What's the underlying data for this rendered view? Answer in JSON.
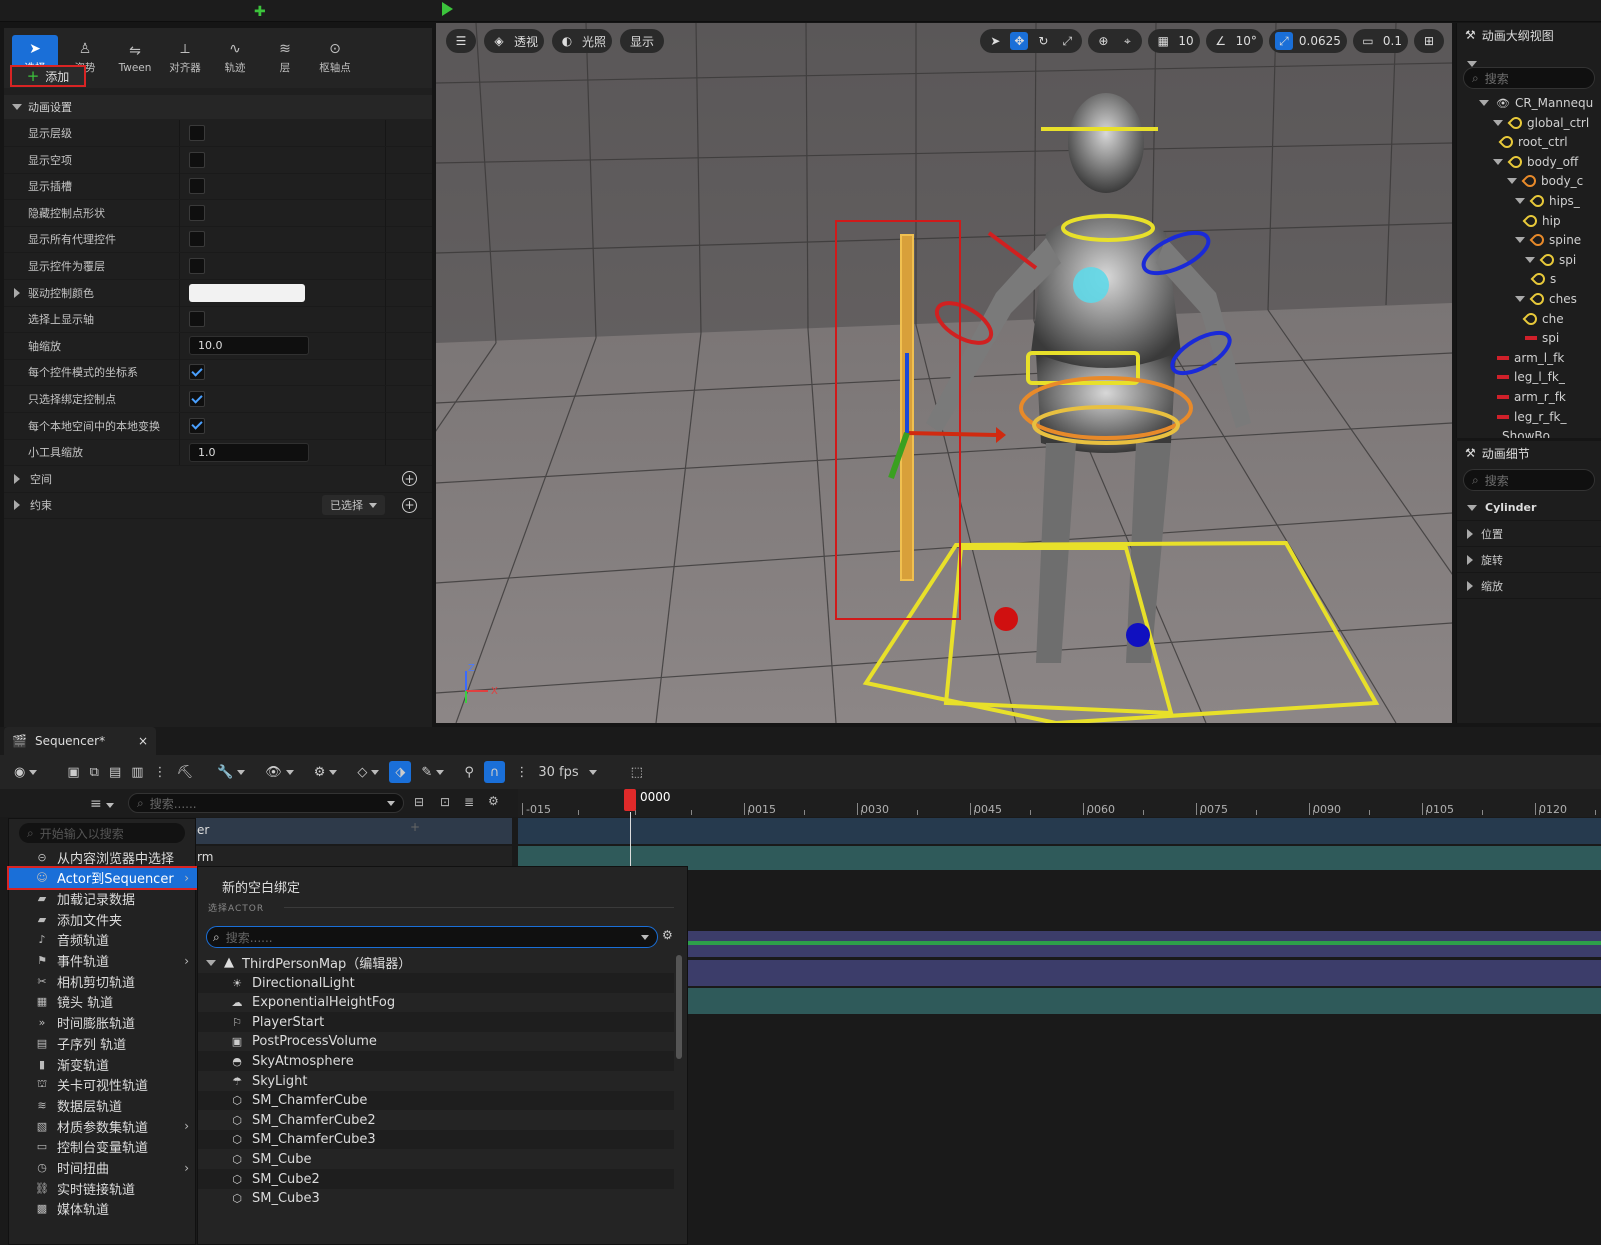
{
  "mode_tabs": [
    {
      "label": "选择",
      "icon": "select-icon"
    },
    {
      "label": "姿势",
      "icon": "pose-icon"
    },
    {
      "label": "Tween",
      "icon": "tween-icon"
    },
    {
      "label": "对齐器",
      "icon": "aligner-icon"
    },
    {
      "label": "轨迹",
      "icon": "trail-icon"
    },
    {
      "label": "层",
      "icon": "layer-icon"
    },
    {
      "label": "枢轴点",
      "icon": "pivot-icon"
    }
  ],
  "anim_settings": {
    "title": "动画设置",
    "rows": [
      {
        "label": "显示层级",
        "type": "checkbox",
        "checked": false
      },
      {
        "label": "显示空项",
        "type": "checkbox",
        "checked": false
      },
      {
        "label": "显示插槽",
        "type": "checkbox",
        "checked": false
      },
      {
        "label": "隐藏控制点形状",
        "type": "checkbox",
        "checked": false
      },
      {
        "label": "显示所有代理控件",
        "type": "checkbox",
        "checked": false
      },
      {
        "label": "显示控件为覆层",
        "type": "checkbox",
        "checked": false
      },
      {
        "label": "驱动控制颜色",
        "type": "color",
        "value": "#f2f2f2"
      },
      {
        "label": "选择上显示轴",
        "type": "checkbox",
        "checked": false
      },
      {
        "label": "轴缩放",
        "type": "number",
        "value": "10.0"
      },
      {
        "label": "每个控件模式的坐标系",
        "type": "checkbox",
        "checked": true
      },
      {
        "label": "只选择绑定控制点",
        "type": "checkbox",
        "checked": true
      },
      {
        "label": "每个本地空间中的本地变换",
        "type": "checkbox",
        "checked": true
      },
      {
        "label": "小工具缩放",
        "type": "number",
        "value": "1.0"
      }
    ],
    "space_label": "空间",
    "constraint_label": "约束",
    "constraint_dropdown": "已选择"
  },
  "viewport": {
    "perspective_label": "透视",
    "lighting_label": "光照",
    "show_label": "显示",
    "grid_snap": "10",
    "angle_snap": "10°",
    "scale_snap": "0.0625",
    "camera_speed": "0.1",
    "axis_x": "X",
    "axis_z": "Z"
  },
  "outliner": {
    "title": "动画大纲视图",
    "search_placeholder": "搜索",
    "items": [
      {
        "label": "CR_Mannequ",
        "kind": "eye"
      },
      {
        "label": "global_ctrl",
        "kind": "bone"
      },
      {
        "label": "root_ctrl",
        "kind": "bone"
      },
      {
        "label": "body_off",
        "kind": "bone"
      },
      {
        "label": "body_c",
        "kind": "bone-orange"
      },
      {
        "label": "hips_",
        "kind": "bone"
      },
      {
        "label": "hip",
        "kind": "bone"
      },
      {
        "label": "spine",
        "kind": "bone-orange"
      },
      {
        "label": "spi",
        "kind": "bone"
      },
      {
        "label": "s",
        "kind": "bone"
      },
      {
        "label": "ches",
        "kind": "bone"
      },
      {
        "label": "che",
        "kind": "bone"
      },
      {
        "label": "spi",
        "kind": "red"
      },
      {
        "label": "arm_l_fk",
        "kind": "red"
      },
      {
        "label": "leg_l_fk_",
        "kind": "red"
      },
      {
        "label": "arm_r_fk",
        "kind": "red"
      },
      {
        "label": "leg_r_fk_",
        "kind": "red"
      },
      {
        "label": "ShowBo",
        "kind": "none"
      }
    ]
  },
  "details": {
    "title": "动画细节",
    "search_placeholder": "搜索",
    "section": "Cylinder",
    "rows": [
      "位置",
      "旋转",
      "缩放"
    ]
  },
  "sequencer": {
    "tab_label": "Sequencer*",
    "fps": "30 fps",
    "add_label": "添加",
    "search_placeholder": "搜索......",
    "playhead_frame": "0000",
    "ticks": [
      "-015",
      "0015",
      "0030",
      "0045",
      "0060",
      "0075",
      "0090",
      "0105",
      "0120"
    ],
    "track_label_1": "er",
    "track_label_2": "rm"
  },
  "add_menu": {
    "search_placeholder": "开始输入以搜索",
    "items": [
      {
        "label": "从内容浏览器中选择",
        "icon": "content-browser-icon",
        "sub": false
      },
      {
        "label": "Actor到Sequencer",
        "icon": "actor-icon",
        "sub": true,
        "highlight": true
      },
      {
        "label": "加载记录数据",
        "icon": "folder-icon",
        "sub": false
      },
      {
        "label": "添加文件夹",
        "icon": "folder-icon",
        "sub": false
      },
      {
        "label": "音频轨道",
        "icon": "audio-icon",
        "sub": false
      },
      {
        "label": "事件轨道",
        "icon": "event-icon",
        "sub": true
      },
      {
        "label": "相机剪切轨道",
        "icon": "camera-cut-icon",
        "sub": false
      },
      {
        "label": "镜头 轨道",
        "icon": "shot-icon",
        "sub": false
      },
      {
        "label": "时间膨胀轨道",
        "icon": "time-dilation-icon",
        "sub": false
      },
      {
        "label": "子序列 轨道",
        "icon": "subsequence-icon",
        "sub": false
      },
      {
        "label": "渐变轨道",
        "icon": "fade-icon",
        "sub": false
      },
      {
        "label": "关卡可视性轨道",
        "icon": "level-visibility-icon",
        "sub": false
      },
      {
        "label": "数据层轨道",
        "icon": "data-layer-icon",
        "sub": false
      },
      {
        "label": "材质参数集轨道",
        "icon": "material-icon",
        "sub": true
      },
      {
        "label": "控制台变量轨道",
        "icon": "console-icon",
        "sub": false
      },
      {
        "label": "时间扭曲",
        "icon": "time-warp-icon",
        "sub": true
      },
      {
        "label": "实时链接轨道",
        "icon": "live-link-icon",
        "sub": false
      },
      {
        "label": "媒体轨道",
        "icon": "media-icon",
        "sub": false
      }
    ]
  },
  "actor_submenu": {
    "new_binding": "新的空白绑定",
    "section": "选择ACTOR",
    "search_placeholder": "搜索......",
    "root": "ThirdPersonMap（编辑器）",
    "actors": [
      {
        "label": "DirectionalLight",
        "icon": "sun-icon"
      },
      {
        "label": "ExponentialHeightFog",
        "icon": "fog-icon"
      },
      {
        "label": "PlayerStart",
        "icon": "player-start-icon"
      },
      {
        "label": "PostProcessVolume",
        "icon": "volume-icon"
      },
      {
        "label": "SkyAtmosphere",
        "icon": "sky-icon"
      },
      {
        "label": "SkyLight",
        "icon": "skylight-icon"
      },
      {
        "label": "SM_ChamferCube",
        "icon": "cube-icon"
      },
      {
        "label": "SM_ChamferCube2",
        "icon": "cube-icon"
      },
      {
        "label": "SM_ChamferCube3",
        "icon": "cube-icon"
      },
      {
        "label": "SM_Cube",
        "icon": "cube-icon"
      },
      {
        "label": "SM_Cube2",
        "icon": "cube-icon"
      },
      {
        "label": "SM_Cube3",
        "icon": "cube-icon"
      }
    ]
  }
}
